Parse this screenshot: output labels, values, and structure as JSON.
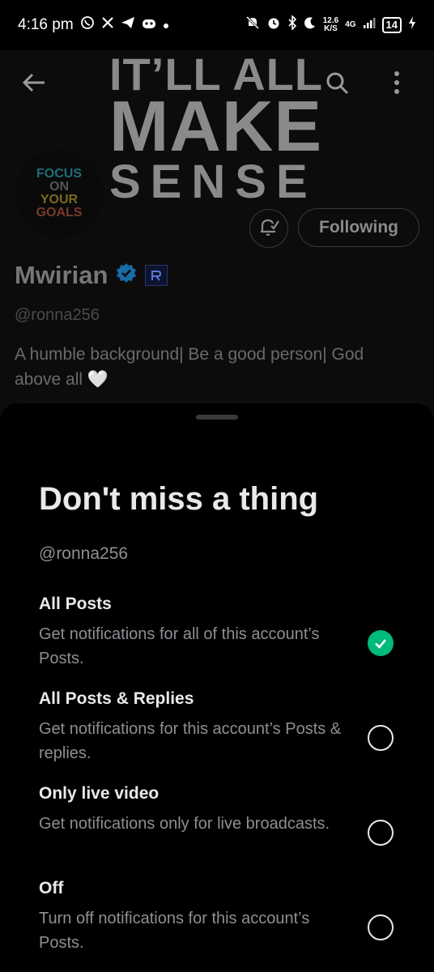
{
  "status_bar": {
    "time": "4:16 pm",
    "network_speed": "12.6",
    "network_unit": "K/S",
    "network_type": "4G",
    "battery": "14"
  },
  "profile": {
    "banner": {
      "line1": "IT’LL ALL",
      "line2": "MAKE",
      "line3": "SENSE"
    },
    "avatar": {
      "line1": "FOCUS",
      "line2": "ON",
      "line3": "YOUR",
      "line4": "GOALS"
    },
    "following_label": "Following",
    "name": "Mwirian",
    "handle": "@ronna256",
    "bio": "A humble background| Be a good person| God above all 🤍"
  },
  "sheet": {
    "title": "Don't miss a thing",
    "handle": "@ronna256",
    "options": [
      {
        "title": "All Posts",
        "description": "Get notifications for all of this account’s Posts.",
        "selected": true
      },
      {
        "title": "All Posts & Replies",
        "description": "Get notifications for this account’s Posts & replies.",
        "selected": false
      },
      {
        "title": "Only live video",
        "description": "Get notifications only for live broadcasts.",
        "selected": false
      },
      {
        "title": "Off",
        "description": "Turn off notifications for this account’s Posts.",
        "selected": false
      }
    ]
  },
  "colors": {
    "background": "#000000",
    "text_primary": "#e7e9ea",
    "text_secondary": "#8b8f93",
    "selected": "#00ba7c",
    "verified": "#1d9bf0"
  }
}
